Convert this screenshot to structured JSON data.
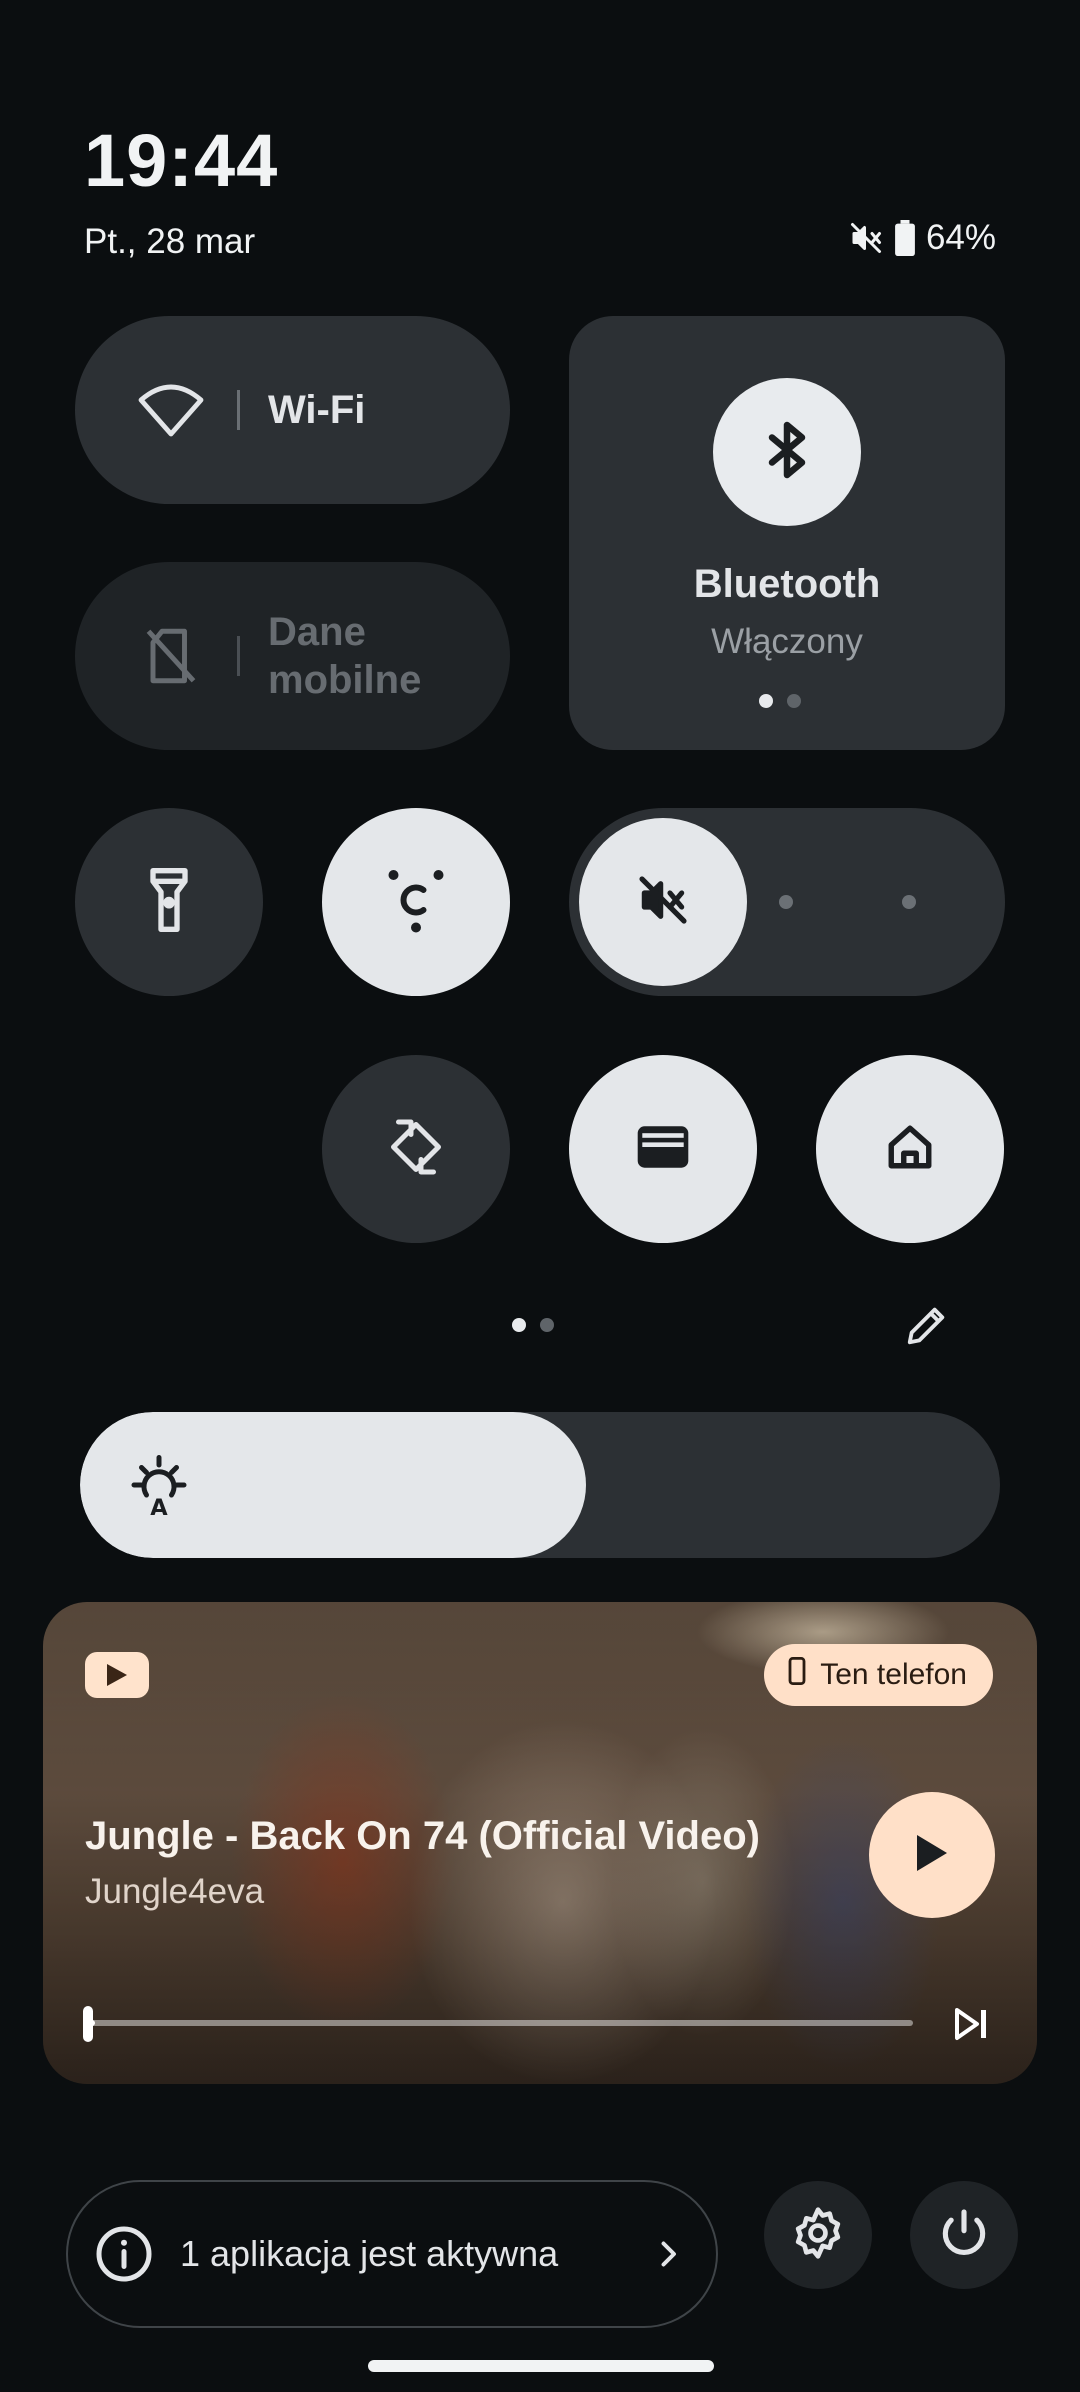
{
  "status_bar": {
    "time": "19:44",
    "date": "Pt., 28 mar",
    "battery": "64%",
    "icons": [
      "mute-icon",
      "battery-icon"
    ]
  },
  "tiles": {
    "wifi": {
      "label": "Wi-Fi",
      "icon": "wifi-icon"
    },
    "mobile_data": {
      "label_line1": "Dane",
      "label_line2": "mobilne",
      "icon": "no-sim-icon"
    },
    "bluetooth": {
      "title": "Bluetooth",
      "subtitle": "Włączony",
      "icon": "bluetooth-icon",
      "page_count": 2,
      "active_page": 1
    },
    "flashlight": {
      "icon": "flashlight-icon",
      "active": false
    },
    "color_correction": {
      "icon": "color-correction-icon",
      "active": true
    },
    "sound_mode": {
      "icon": "mute-icon",
      "selected_index": 0,
      "options": 3
    },
    "auto_rotate": {
      "icon": "auto-rotate-icon",
      "active": false
    },
    "wallet": {
      "icon": "wallet-icon",
      "active": true
    },
    "home": {
      "icon": "home-icon",
      "active": true
    }
  },
  "pager": {
    "pages": 2,
    "active": 1
  },
  "brightness": {
    "icon": "auto-brightness-icon",
    "level": 0.55
  },
  "media": {
    "app_icon": "youtube-icon",
    "output_device": "Ten telefon",
    "title": "Jungle - Back On 74 (Official Video)",
    "artist": "Jungle4eva",
    "progress": 0.01,
    "colors": {
      "accent": "#ffe0c8"
    }
  },
  "footer": {
    "active_apps": "1 aplikacja jest aktywna"
  }
}
